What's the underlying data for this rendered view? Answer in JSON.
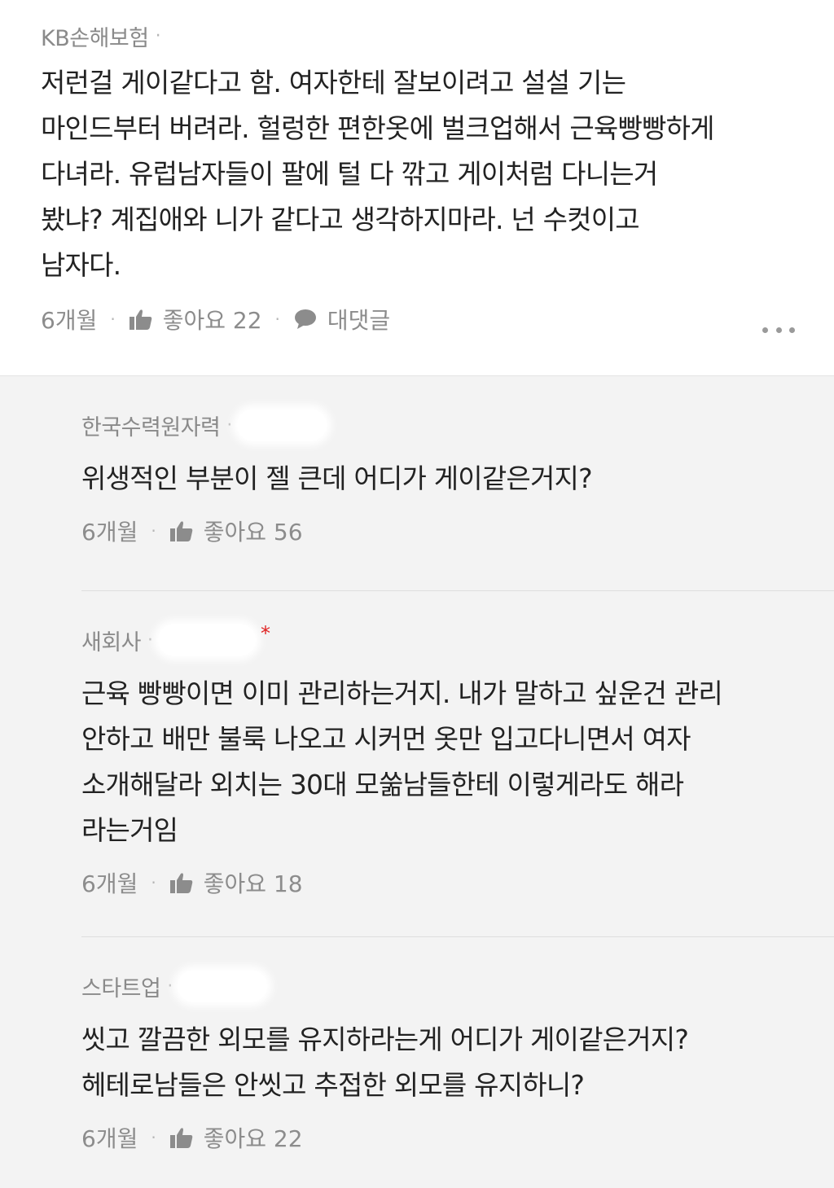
{
  "top_comment": {
    "author": "KB손해보험",
    "text": "저런걸 게이같다고 함. 여자한테 잘보이려고 설설 기는\n마인드부터 버려라. 헐렁한 편한옷에 벌크업해서 근육빵빵하게\n다녀라. 유럽남자들이 팔에 털 다 깎고 게이처럼 다니는거\n봤냐? 계집애와 니가 같다고 생각하지마라. 넌 수컷이고\n남자다.",
    "time": "6개월",
    "like_label": "좋아요 22",
    "reply_label": "대댓글"
  },
  "replies": [
    {
      "author": "한국수력원자력",
      "text": "위생적인 부분이 젤 큰데 어디가 게이같은거지?",
      "time": "6개월",
      "like_label": "좋아요 56"
    },
    {
      "author": "새회사",
      "marker": "*",
      "text": "근육 빵빵이면 이미 관리하는거지. 내가 말하고 싶운건 관리\n안하고 배만 불룩 나오고 시커먼 옷만 입고다니면서 여자\n소개해달라 외치는 30대 모쑮남들한테 이렇게라도 해라\n라는거임",
      "time": "6개월",
      "like_label": "좋아요 18"
    },
    {
      "author": "스타트업",
      "text": "씻고 깔끔한 외모를 유지하라는게 어디가 게이같은거지?\n헤테로남들은 안씻고 추접한 외모를 유지하니?",
      "time": "6개월",
      "like_label": "좋아요 22"
    }
  ],
  "colors": {
    "reply_background": "#f3f3f3",
    "meta_text": "#8c8c8c",
    "marker": "#e02020"
  },
  "icons": [
    "thumbs-up-icon",
    "speech-bubble-icon",
    "more-dots-icon"
  ]
}
